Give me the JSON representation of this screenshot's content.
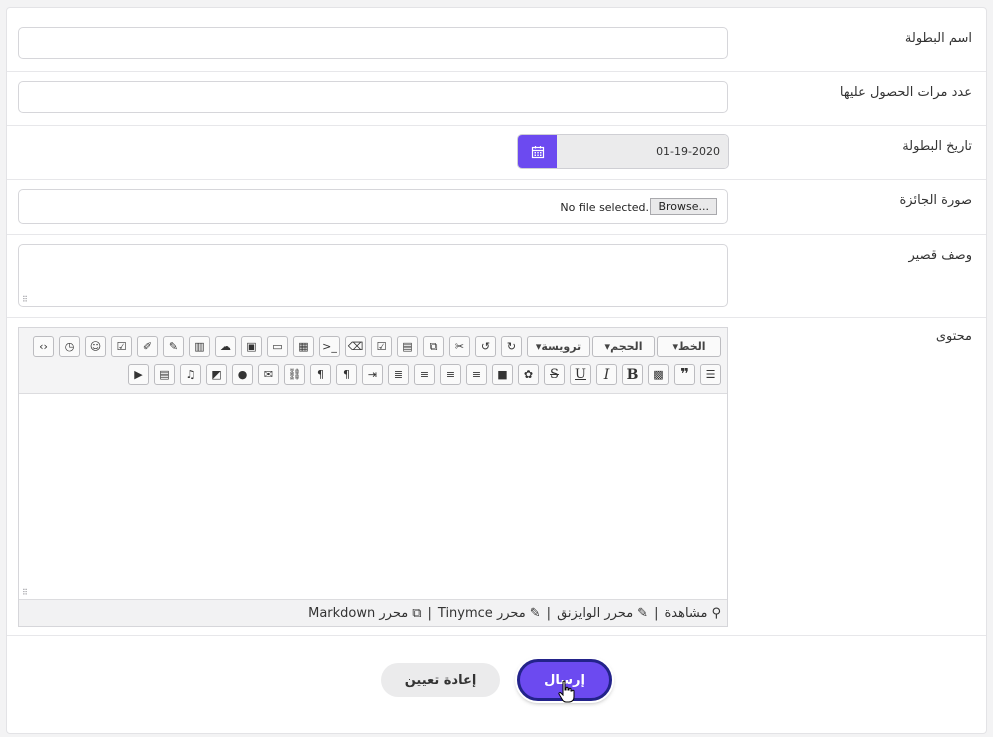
{
  "form": {
    "name_label": "اسم البطولة",
    "times_label": "عدد مرات الحصول عليها",
    "date_label": "تاريخ البطولة",
    "date_value": "01-19-2020",
    "image_label": "صورة الجائزة",
    "browse_label": "Browse...",
    "no_file_text": "No file selected.",
    "short_desc_label": "وصف قصير",
    "content_label": "محتوى"
  },
  "editor": {
    "font_label": "الخط",
    "size_label": "الحجم",
    "heading_label": "ترويسة",
    "footer": {
      "preview": "مشاهدة",
      "sep": "|",
      "wysiwyg": "محرر الوايزنق",
      "tinymce": "محرر Tinymce",
      "markdown": "محرر Markdown"
    }
  },
  "buttons": {
    "submit": "إرسال",
    "reset": "إعادة تعيين"
  },
  "colors": {
    "accent": "#6c4af0",
    "submit_border": "#23238a"
  }
}
